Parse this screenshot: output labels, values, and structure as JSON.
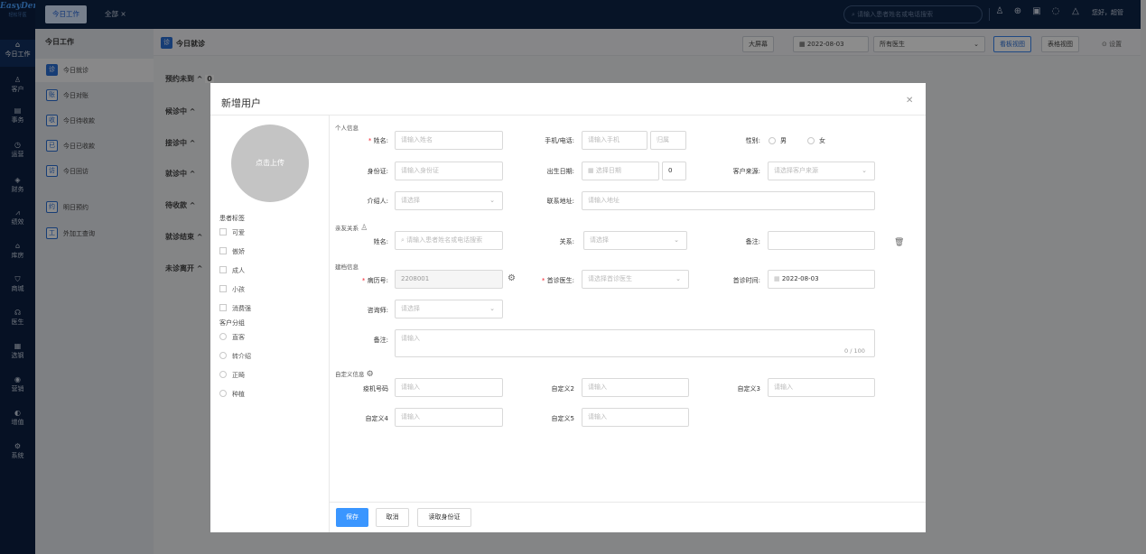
{
  "app": {
    "logo": "EasyDent",
    "logo_sub": "轻松牙医"
  },
  "rail": [
    {
      "icon": "⌂",
      "label": "今日工作"
    },
    {
      "icon": "♙",
      "label": "客户"
    },
    {
      "icon": "▤",
      "label": "事务"
    },
    {
      "icon": "◷",
      "label": "运营"
    },
    {
      "icon": "◈",
      "label": "财务"
    },
    {
      "icon": "⩘",
      "label": "绩效"
    },
    {
      "icon": "⌂",
      "label": "库房"
    },
    {
      "icon": "⛉",
      "label": "商城"
    },
    {
      "icon": "☊",
      "label": "医生"
    },
    {
      "icon": "▦",
      "label": "选钢"
    },
    {
      "icon": "◉",
      "label": "营销"
    },
    {
      "icon": "◐",
      "label": "增值"
    },
    {
      "icon": "⚙",
      "label": "系统"
    }
  ],
  "topbar": {
    "tabs": [
      "今日工作",
      "全部 ×"
    ],
    "search_placeholder": "请输入患者姓名或电话搜索",
    "greeting": "您好，超管"
  },
  "sidebar": {
    "title": "今日工作",
    "items": [
      {
        "icon": "诊",
        "label": "今日就诊"
      },
      {
        "icon": "账",
        "label": "今日对账"
      },
      {
        "icon": "收",
        "label": "今日待收款"
      },
      {
        "icon": "已",
        "label": "今日已收款"
      },
      {
        "icon": "访",
        "label": "今日回访"
      },
      {
        "icon": "约",
        "label": "明日预约"
      },
      {
        "icon": "工",
        "label": "外加工查询"
      }
    ]
  },
  "main": {
    "title": "今日就诊",
    "buttons": {
      "bigscreen": "大屏幕",
      "date": "2022-08-03",
      "doctor": "所有医生",
      "board_view": "看板视图",
      "table_view": "表格视图",
      "settings": "设置"
    },
    "columns": [
      {
        "label": "预约未到",
        "count": "0"
      },
      {
        "label": "候诊中",
        "count": ""
      },
      {
        "label": "接诊中",
        "count": ""
      },
      {
        "label": "就诊中",
        "count": ""
      },
      {
        "label": "待收款",
        "count": ""
      },
      {
        "label": "就诊结束",
        "count": ""
      },
      {
        "label": "未诊离开",
        "count": ""
      }
    ]
  },
  "modal": {
    "title": "新增用户",
    "upload": "点击上传",
    "tag_group_title": "患者标签",
    "tags": [
      "可爱",
      "傲娇",
      "成人",
      "小孩",
      "消费强"
    ],
    "cust_group_title": "客户分组",
    "groups": [
      "直客",
      "转介绍",
      "正畸",
      "种植"
    ],
    "sections": {
      "personal": "个人信息",
      "relatives": "亲友关系",
      "archive": "建档信息",
      "custom": "自定义信息"
    },
    "fields": {
      "name_label": "姓名:",
      "name_ph": "请输入姓名",
      "phone_label": "手机/电话:",
      "phone_ph": "请输入手机",
      "region_ph": "归属",
      "gender_label": "性别:",
      "male": "男",
      "female": "女",
      "id_label": "身份证:",
      "id_ph": "请输入身份证",
      "birth_label": "出生日期:",
      "birth_ph": "选择日期",
      "age": "0",
      "source_label": "客户来源:",
      "source_ph": "请选择客户来源",
      "referrer_label": "介绍人:",
      "referrer_ph": "请选择",
      "address_label": "联系地址:",
      "address_ph": "请输入地址",
      "rel_name_label": "姓名:",
      "rel_name_ph": "请输入患者姓名或电话搜索",
      "relation_label": "关系:",
      "relation_ph": "请选择",
      "rel_note_label": "备注:",
      "record_label": "病历号:",
      "record_value": "2208001",
      "first_doc_label": "首诊医生:",
      "first_doc_ph": "请选择首诊医生",
      "first_time_label": "首诊时间:",
      "first_time_value": "2022-08-03",
      "consultant_label": "咨询师:",
      "consultant_ph": "请选择",
      "note_label": "备注:",
      "note_ph": "请输入",
      "note_count": "0 / 100",
      "c1_label": "疫机号码",
      "c1_ph": "请输入",
      "c2_label": "自定义2",
      "c2_ph": "请输入",
      "c3_label": "自定义3",
      "c3_ph": "请输入",
      "c4_label": "自定义4",
      "c4_ph": "请输入",
      "c5_label": "自定义5",
      "c5_ph": "请输入"
    },
    "footer": {
      "save": "保存",
      "cancel": "取消",
      "read_id": "读取身份证"
    }
  }
}
